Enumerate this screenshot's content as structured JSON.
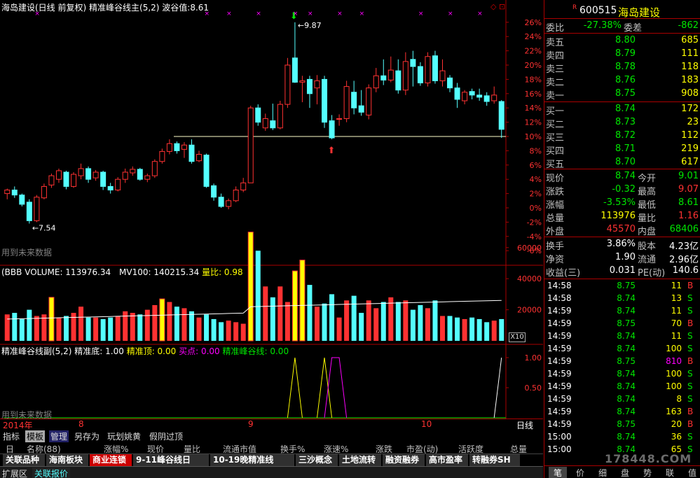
{
  "main_header": {
    "title": "海岛建设(日线 前复权)",
    "indicator": "精准峰谷线主(5,2)",
    "wave_label": "波谷值:",
    "wave_value": "8.61"
  },
  "main_chart": {
    "y_ticks": [
      "26%",
      "24%",
      "22%",
      "20%",
      "18%",
      "16%",
      "14%",
      "12%",
      "10%",
      "8%",
      "6%",
      "4%",
      "2%",
      "0%",
      "-2%",
      "-4%",
      "-6%"
    ],
    "high_label": "9.87",
    "low_label": "7.54",
    "future_note": "用到未来数据",
    "support_line_pct": 10
  },
  "chart_data": {
    "type": "candlestick",
    "unit": "%",
    "candles": [
      [
        2.0,
        2.5,
        1.2,
        2.7
      ],
      [
        2.5,
        1.8,
        1.4,
        3.0
      ],
      [
        1.8,
        0.5,
        0.2,
        2.0
      ],
      [
        0.8,
        -1.8,
        -2.2,
        1.2
      ],
      [
        -1.8,
        1.5,
        -2.0,
        1.8
      ],
      [
        1.4,
        3.0,
        1.2,
        3.4
      ],
      [
        3.2,
        4.5,
        2.8,
        4.8
      ],
      [
        4.0,
        5.2,
        3.5,
        5.5
      ],
      [
        5.0,
        3.0,
        2.6,
        5.2
      ],
      [
        3.0,
        4.7,
        2.8,
        5.0
      ],
      [
        4.5,
        5.5,
        4.0,
        6.2
      ],
      [
        5.5,
        4.0,
        3.5,
        5.8
      ],
      [
        4.2,
        5.0,
        3.8,
        5.3
      ],
      [
        5.0,
        3.0,
        2.5,
        5.2
      ],
      [
        3.0,
        2.5,
        2.0,
        3.5
      ],
      [
        2.5,
        4.0,
        2.3,
        4.3
      ],
      [
        4.0,
        5.0,
        3.5,
        5.5
      ],
      [
        4.9,
        5.4,
        4.5,
        5.8
      ],
      [
        5.4,
        4.0,
        3.8,
        5.6
      ],
      [
        4.0,
        4.5,
        3.6,
        4.8
      ],
      [
        4.5,
        6.5,
        4.2,
        6.8
      ],
      [
        6.5,
        7.9,
        6.2,
        8.3
      ],
      [
        7.9,
        9.0,
        7.5,
        9.6
      ],
      [
        9.0,
        8.0,
        7.6,
        9.3
      ],
      [
        8.2,
        8.8,
        7.0,
        9.2
      ],
      [
        8.8,
        6.5,
        6.2,
        9.6
      ],
      [
        6.6,
        7.5,
        6.4,
        8.0
      ],
      [
        7.4,
        3.0,
        2.8,
        7.6
      ],
      [
        3.1,
        1.5,
        1.0,
        3.4
      ],
      [
        1.5,
        0.2,
        0.0,
        2.0
      ],
      [
        0.2,
        1.0,
        -0.2,
        1.3
      ],
      [
        1.0,
        2.5,
        0.8,
        3.0
      ],
      [
        2.5,
        3.5,
        2.2,
        4.2
      ],
      [
        3.5,
        14.0,
        3.5,
        14.3
      ],
      [
        14.0,
        12.0,
        11.5,
        14.5
      ],
      [
        11.2,
        12.5,
        10.8,
        13.2
      ],
      [
        12.2,
        11.2,
        10.9,
        14.6
      ],
      [
        11.2,
        14.5,
        11.0,
        15.0
      ],
      [
        14.5,
        20.0,
        14.0,
        21.0
      ],
      [
        21.0,
        17.6,
        17.5,
        26.0
      ],
      [
        17.6,
        17.8,
        14.8,
        18.5
      ],
      [
        18.0,
        16.0,
        14.0,
        18.5
      ],
      [
        16.8,
        17.8,
        14.5,
        18.6
      ],
      [
        18.0,
        12.0,
        11.2,
        18.5
      ],
      [
        12.2,
        9.8,
        9.6,
        13.0
      ],
      [
        12.4,
        12.5,
        11.5,
        13.1
      ],
      [
        12.5,
        17.0,
        12.0,
        17.8
      ],
      [
        16.2,
        14.0,
        13.1,
        17.8
      ],
      [
        14.3,
        13.4,
        12.9,
        16.5
      ],
      [
        13.0,
        16.8,
        12.4,
        17.3
      ],
      [
        16.8,
        18.5,
        16.2,
        19.6
      ],
      [
        18.5,
        17.9,
        17.2,
        20.8
      ],
      [
        17.9,
        19.3,
        17.6,
        21.2
      ],
      [
        19.2,
        16.5,
        16.0,
        20.8
      ],
      [
        16.5,
        20.5,
        15.8,
        21.8
      ],
      [
        20.8,
        19.8,
        17.0,
        22.0
      ],
      [
        19.8,
        17.5,
        17.1,
        20.4
      ],
      [
        17.5,
        21.2,
        17.0,
        21.8
      ],
      [
        21.3,
        17.8,
        17.4,
        22.0
      ],
      [
        17.8,
        19.2,
        17.0,
        20.8
      ],
      [
        18.2,
        16.8,
        16.2,
        18.6
      ],
      [
        16.8,
        15.2,
        14.0,
        17.5
      ],
      [
        15.0,
        16.2,
        14.5,
        16.5
      ],
      [
        16.3,
        15.8,
        15.2,
        16.7
      ],
      [
        15.8,
        15.5,
        15.0,
        16.7
      ],
      [
        15.7,
        14.9,
        14.3,
        16.2
      ],
      [
        15.0,
        15.8,
        14.6,
        17.0
      ],
      [
        14.9,
        11.0,
        9.8,
        15.1
      ]
    ],
    "volume": [
      17000,
      18000,
      14000,
      20000,
      16000,
      17000,
      28000,
      15000,
      16000,
      18000,
      22000,
      15000,
      15000,
      14000,
      15000,
      16000,
      19000,
      18000,
      17000,
      20000,
      23000,
      27000,
      25000,
      22000,
      21000,
      19000,
      15000,
      17000,
      14000,
      12000,
      13000,
      12000,
      11000,
      70000,
      58000,
      35000,
      28000,
      35000,
      25000,
      45000,
      52000,
      36000,
      22000,
      24000,
      30000,
      15000,
      26000,
      29000,
      18000,
      26000,
      21000,
      25000,
      28000,
      25000,
      26000,
      20000,
      23000,
      21000,
      26000,
      16000,
      16000,
      15000,
      14000,
      15000,
      14000,
      12000,
      13000,
      14000
    ],
    "volume_marks": [
      6,
      21,
      33,
      39,
      40
    ],
    "signals": [
      0,
      0,
      0,
      0,
      0,
      0,
      0,
      0,
      0,
      0,
      0,
      0,
      0,
      0,
      0,
      0,
      0,
      0,
      0,
      0,
      0,
      0,
      0,
      0,
      0,
      0,
      0,
      0,
      0,
      0,
      0,
      0,
      0,
      0,
      0,
      0,
      0,
      0,
      0,
      0,
      0,
      0,
      0,
      0,
      0,
      0,
      0,
      0,
      0,
      0,
      0,
      0,
      0,
      0,
      0,
      0,
      0,
      0,
      0,
      0,
      0,
      0,
      0,
      0,
      0,
      0,
      0,
      1
    ]
  },
  "volume_header": {
    "label": "(BBB VOLUME: 113976.34",
    "mv_label": "MV100: 140215.34",
    "ratio_label": "量比: 0.98"
  },
  "volume_axis": {
    "ticks": [
      "60000",
      "40000",
      "20000"
    ],
    "scale": "X10"
  },
  "sub_header": {
    "name": "精准峰谷线副(5,2)",
    "bottom": "精准底: 1.00",
    "top": "精准顶: 0.00",
    "buy": "买点: 0.00",
    "line": "精准峰谷线: 0.00"
  },
  "sub_axis": {
    "ticks": [
      "1.00",
      "0.50"
    ]
  },
  "sub_note": "用到未来数据",
  "date_axis": {
    "year": "2014年",
    "months": [
      "8",
      "9",
      "10"
    ],
    "period": "日线"
  },
  "toolbar": {
    "items": [
      "指标",
      "模板",
      "管理",
      "另存为",
      "玩划姚黄",
      "假阴过顶"
    ]
  },
  "columns": {
    "items": [
      "日",
      "名称(88)",
      "涨幅%",
      "现价",
      "量比",
      "流通市值",
      "换手%",
      "涨速%",
      "涨跌",
      "市盈(动)",
      "活跃度",
      "总量"
    ]
  },
  "tabs": {
    "items": [
      "关联品种",
      "海南板块",
      "商业连锁",
      "9-11峰谷线日",
      "10-19晚精准线",
      "三沙概念",
      "土地流转",
      "融资融券",
      "高市盈率",
      "转融券SH"
    ],
    "active": 2
  },
  "status": {
    "left": "扩展区",
    "right": "关联报价"
  },
  "quote": {
    "code": "600515",
    "name": "海岛建设",
    "flag": "R",
    "weibi_label": "委比",
    "weibi": "-27.38%",
    "weicha_label": "委差",
    "weicha": "-862",
    "asks": [
      {
        "label": "卖五",
        "price": "8.80",
        "vol": "685"
      },
      {
        "label": "卖四",
        "price": "8.79",
        "vol": "111"
      },
      {
        "label": "卖三",
        "price": "8.78",
        "vol": "118"
      },
      {
        "label": "卖二",
        "price": "8.76",
        "vol": "183"
      },
      {
        "label": "卖一",
        "price": "8.75",
        "vol": "908"
      }
    ],
    "bids": [
      {
        "label": "买一",
        "price": "8.74",
        "vol": "172"
      },
      {
        "label": "买二",
        "price": "8.73",
        "vol": "23"
      },
      {
        "label": "买三",
        "price": "8.72",
        "vol": "112"
      },
      {
        "label": "买四",
        "price": "8.71",
        "vol": "219"
      },
      {
        "label": "买五",
        "price": "8.70",
        "vol": "617"
      }
    ],
    "stats": [
      {
        "l1": "现价",
        "v1": "8.74",
        "c1": "grn",
        "l2": "今开",
        "v2": "9.01",
        "c2": "grn"
      },
      {
        "l1": "涨跌",
        "v1": "-0.32",
        "c1": "grn",
        "l2": "最高",
        "v2": "9.07",
        "c2": "red"
      },
      {
        "l1": "涨幅",
        "v1": "-3.53%",
        "c1": "grn",
        "l2": "最低",
        "v2": "8.61",
        "c2": "grn"
      },
      {
        "l1": "总量",
        "v1": "113976",
        "c1": "yel",
        "l2": "量比",
        "v2": "1.16",
        "c2": "red"
      },
      {
        "l1": "外盘",
        "v1": "45570",
        "c1": "red",
        "l2": "内盘",
        "v2": "68406",
        "c2": "grn"
      }
    ],
    "finance": [
      {
        "l1": "换手",
        "v1": "3.86%",
        "l2": "股本",
        "v2": "4.23亿"
      },
      {
        "l1": "净资",
        "v1": "1.90",
        "l2": "流通",
        "v2": "2.96亿"
      },
      {
        "l1": "收益(三)",
        "v1": "0.031",
        "l2": "PE(动)",
        "v2": "140.6"
      }
    ]
  },
  "ticks": [
    {
      "time": "14:58",
      "price": "8.75",
      "vol": "11",
      "side": "B"
    },
    {
      "time": "14:58",
      "price": "8.74",
      "vol": "13",
      "side": "S"
    },
    {
      "time": "14:59",
      "price": "8.74",
      "vol": "11",
      "side": "S"
    },
    {
      "time": "14:59",
      "price": "8.75",
      "vol": "70",
      "side": "B"
    },
    {
      "time": "14:59",
      "price": "8.74",
      "vol": "11",
      "side": "S"
    },
    {
      "time": "14:59",
      "price": "8.74",
      "vol": "100",
      "side": "S"
    },
    {
      "time": "14:59",
      "price": "8.75",
      "vol": "810",
      "side": "B"
    },
    {
      "time": "14:59",
      "price": "8.74",
      "vol": "100",
      "side": "S"
    },
    {
      "time": "14:59",
      "price": "8.74",
      "vol": "100",
      "side": "S"
    },
    {
      "time": "14:59",
      "price": "8.74",
      "vol": "8",
      "side": "S"
    },
    {
      "time": "14:59",
      "price": "8.74",
      "vol": "163",
      "side": "B"
    },
    {
      "time": "14:59",
      "price": "8.75",
      "vol": "20",
      "side": "B"
    },
    {
      "time": "15:00",
      "price": "8.74",
      "vol": "36",
      "side": "S"
    },
    {
      "time": "15:00",
      "price": "8.74",
      "vol": "65",
      "side": "S"
    }
  ],
  "bottom_tabs": {
    "items": [
      "笔",
      "价",
      "细",
      "盘",
      "势",
      "联",
      "值"
    ]
  },
  "watermark": "178448.COM"
}
